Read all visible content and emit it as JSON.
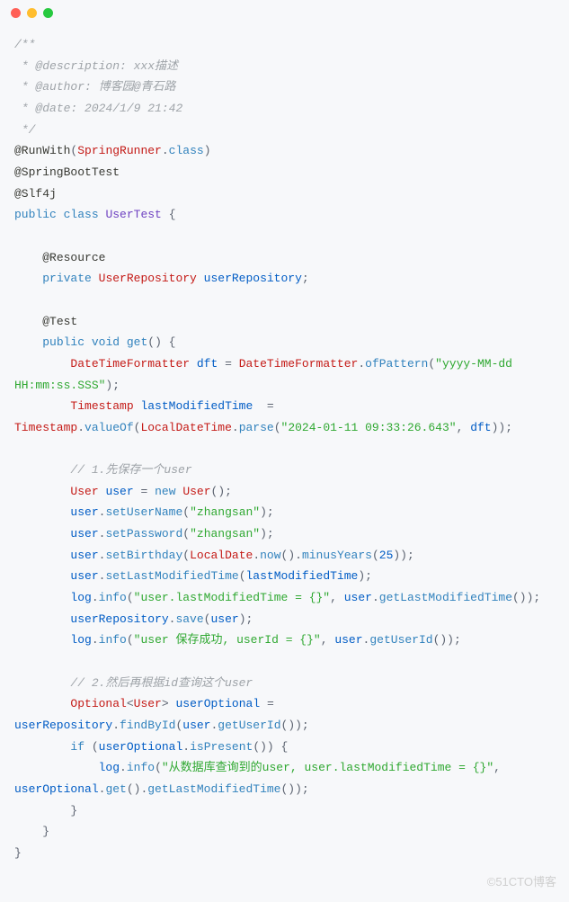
{
  "code": {
    "line1": "/**",
    "line2": " * @description: xxx描述",
    "line3": " * @author: 博客园@青石路",
    "line4": " * @date: 2024/1/9 21:42",
    "line5": " */",
    "annoRunWith": "@RunWith",
    "springRunner": "SpringRunner",
    "classKw": "class",
    "annoSpringBootTest": "@SpringBootTest",
    "annoSlf4j": "@Slf4j",
    "public": "public",
    "private": "private",
    "void": "void",
    "new": "new",
    "if": "if",
    "classUserTest": "UserTest",
    "annoResource": "@Resource",
    "typeUserRepository": "UserRepository",
    "varUserRepository": "userRepository",
    "annoTest": "@Test",
    "methodGet": "get",
    "typeDateTimeFormatter": "DateTimeFormatter",
    "varDft": "dft",
    "ofPattern": "ofPattern",
    "patternStr": "\"yyyy-MM-dd HH:mm:ss.SSS\"",
    "typeTimestamp": "Timestamp",
    "varLastModifiedTime": "lastModifiedTime",
    "valueOf": "valueOf",
    "typeLocalDateTime": "LocalDateTime",
    "parse": "parse",
    "dateStr": "\"2024-01-11 09:33:26.643\"",
    "comment1": "// 1.先保存一个user",
    "typeUser": "User",
    "varUser": "user",
    "setUserName": "setUserName",
    "strZhangsan": "\"zhangsan\"",
    "setPassword": "setPassword",
    "setBirthday": "setBirthday",
    "typeLocalDate": "LocalDate",
    "now": "now",
    "minusYears": "minusYears",
    "num25": "25",
    "setLastModifiedTime": "setLastModifiedTime",
    "varLog": "log",
    "info": "info",
    "strLastMod": "\"user.lastModifiedTime = {}\"",
    "getLastModifiedTime": "getLastModifiedTime",
    "save": "save",
    "strSaveOk": "\"user 保存成功, userId = {}\"",
    "getUserId": "getUserId",
    "comment2": "// 2.然后再根据id查询这个user",
    "typeOptional": "Optional",
    "varUserOptional": "userOptional",
    "findById": "findById",
    "isPresent": "isPresent",
    "strDbQuery": "\"从数据库查询到的user, user.lastModifiedTime = {}\"",
    "get": "get"
  },
  "watermark": "©51CTO博客"
}
